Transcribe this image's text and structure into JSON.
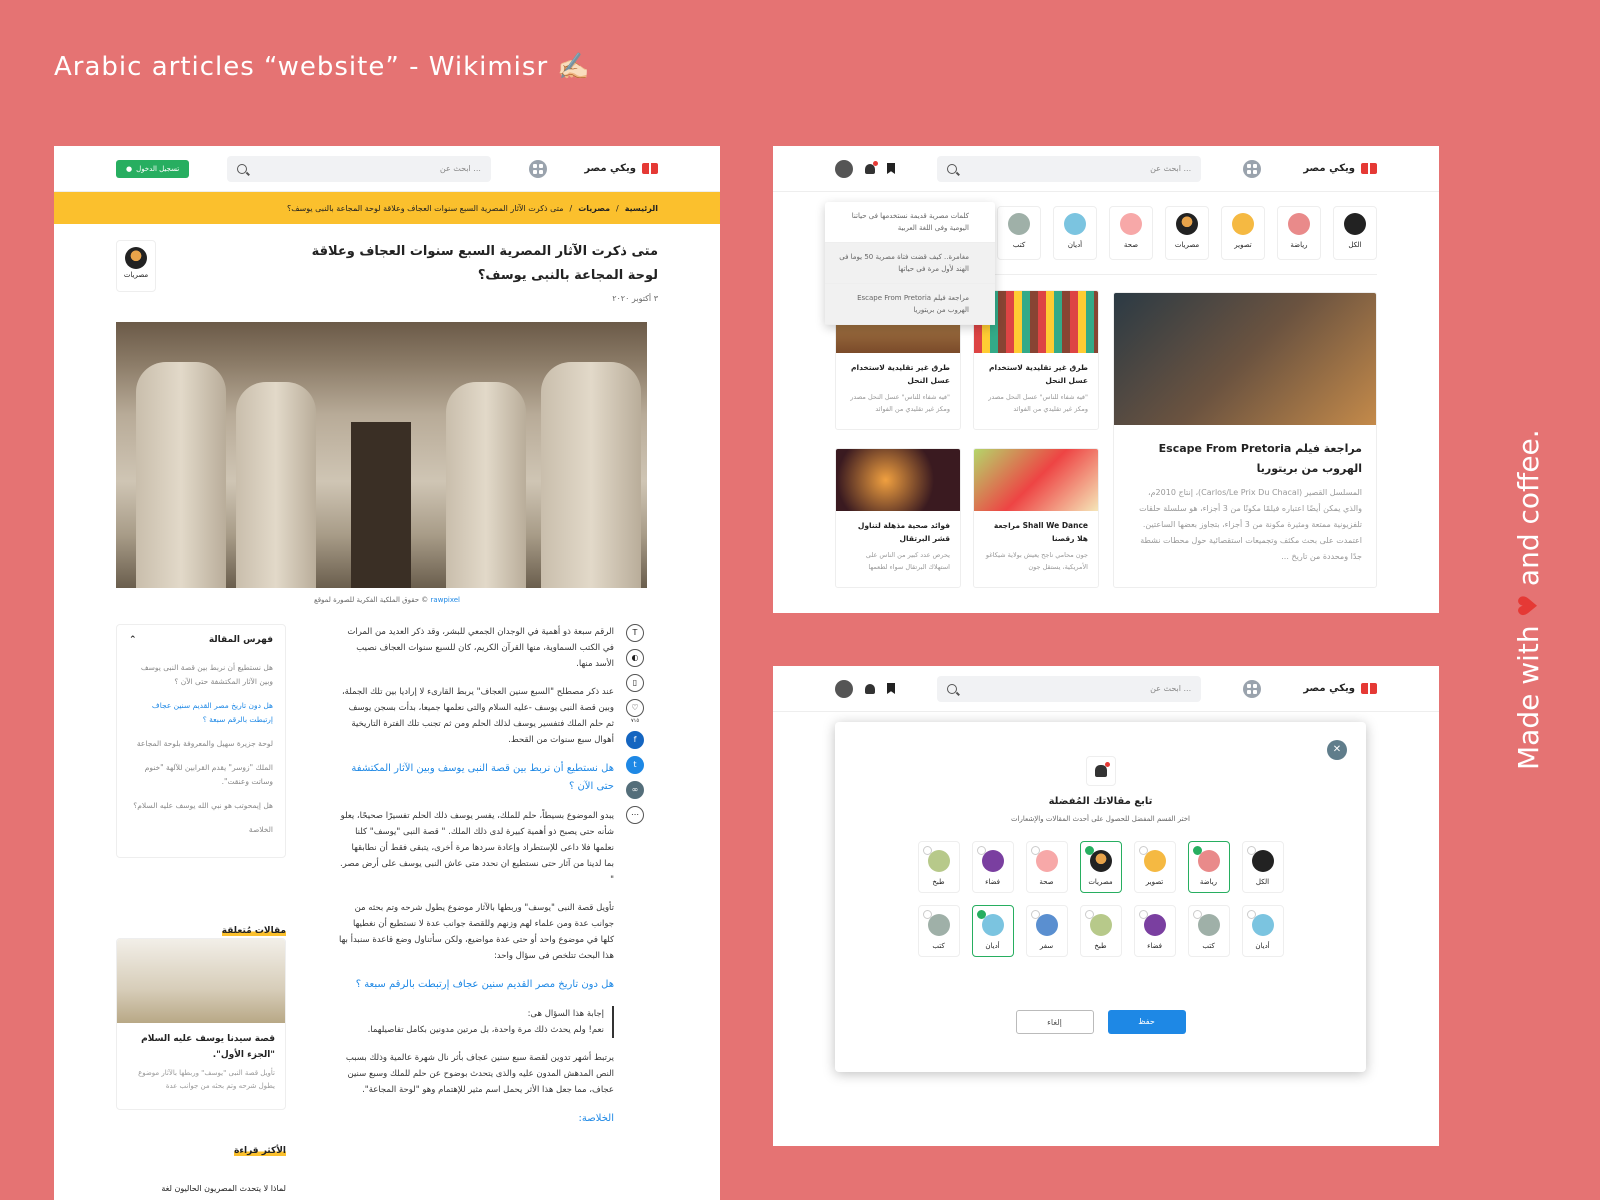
{
  "title": "Arabic articles “website” - Wikimisr ✍🏻",
  "side": {
    "prefix": "Made with",
    "suffix": "and coffee."
  },
  "brand": "ويكي مصر",
  "search_placeholder": "ابحث عن ...",
  "login": "تسجيل الدخول",
  "crumbs": [
    "الرئيسية",
    "مصريات",
    "متى ذكرت الآثار المصرية السبع سنوات العجاف وعلاقة لوحة المجاعة بالنبى يوسف؟"
  ],
  "article": {
    "title": "متى ذكرت الآثار المصرية السبع سنوات العجاف وعلاقة لوحة المجاعة بالنبى يوسف؟",
    "date": "٣ أكتوبر ٢٠٢٠",
    "category": "مصريات",
    "credit": "© حقوق الملكية الفكرية للصورة لموقع",
    "credit_link": "rawpixel",
    "likes": "٧١٥"
  },
  "body": {
    "p1": "الرقم سبعة ذو أهمية في الوجدان الجمعي للبشر، وقد ذكر العديد من المرات في الكتب السماوية، منها القرآن الكريم، كان للسبع سنوات العجاف نصيب الأسد منها.",
    "p2": "عند ذكر مصطلح \"السبع سنين العجاف\" يربط القارىء لا إراديا بين تلك الجملة، وبين قصة النبى يوسف -عليه السلام والتى نعلمها جميعا، بدأت بسجن يوسف ثم حلم الملك فتفسير يوسف لذلك الحلم ومن ثم تجنب تلك الفترة التاريخية أهوال سبع سنوات من القحط.",
    "h1": "هل نستطيع أن نربط بين قصة النبى يوسف وبين الآثار المكتشفة حتى الآن ؟",
    "p3": "يبدو الموضوع بسيطاً، حلم للملك، يفسر يوسف ذلك الحلم تفسيرًا صحيحًا، يعلو شأنه حتى يصبح ذو أهمية كبيرة لدى ذلك الملك. \" قصة النبى \"يوسف\" كلنا نعلمها فلا داعى للإستطراد وإعادة سردها مرة أخرى، يتبقى فقط أن نطابقها بما لدينا من آثار حتى نستطيع ان نحدد متى عاش النبى يوسف على أرض مصر. \"",
    "p4": "تأويل قصة النبى \"يوسف\" وربطها بالآثار موضوع يطول شرحه وتم بحثه من جوانب عدة ومن علماء لهم وزنهم وللقصة جوانب عدة لا نستطيع أن نغطيها كلها في موضوع واحد أو حتى عدة مواضيع، ولكن سأتناول وضع قاعدة سنبدأ بها هذا البحث تتلخص فى سؤال واحد:",
    "h2": "هل دون تاريخ مصر القديم سنين عجاف إرتبطت بالرقم سبعة ؟",
    "q1": "إجابة هذا السؤال هى:",
    "q2": "نعم! ولم يحدث ذلك مرة واحدة، بل مرتين مدونين بكامل تفاصيلهما.",
    "p5": "يرتبط أشهر تدوين لقصة سبع سنين عجاف بأثر نال شهرة عالمية وذلك بسبب النص المدهش المدون عليه والذى يتحدث بوضوح عن حلم للملك وسبع سنين عجاف، مما جعل هذا الأثر يحمل اسم مثير للإهتمام وهو \"لوحة المجاعة\".",
    "h3": "الخلاصة:"
  },
  "toc": {
    "title": "فهرس المقالة",
    "items": [
      "هل نستطيع أن نربط بين قصة النبى يوسف وبين الآثار المكتشفة حتى الآن ؟",
      "هل دون تاريخ مصر القديم سنين عجاف إرتبطت بالرقم سبعة ؟",
      "لوحة جزيرة سهيل والمعروفة بلوحة المجاعة",
      "الملك \"زوسر\" يقدم القرابين للآلهة \"خنوم وساتت وعنقت\".",
      "هل إيمحوتب هو نبي الله يوسف عليه السلام؟",
      "الخلاصة"
    ]
  },
  "related": {
    "title": "مقالات مُتعلقة",
    "card_title": "قصة سيدنا يوسف عليه السلام \"الجزء الأول\".",
    "card_desc": "تأويل قصة النبى \"يوسف\" وربطها بالآثار موضوع يطول شرحه وتم بحثه من جوانب عدة"
  },
  "popular": {
    "title": "الأكثر قراءة",
    "first": "لماذا لا يتحدث المصريون الحاليون لغة"
  },
  "categories": [
    "الكل",
    "رياضة",
    "تصوير",
    "مصريات",
    "صحة",
    "أديان",
    "كتب"
  ],
  "notifications": [
    "كلمات مصرية قديمة نستخدمها فى حياتنا اليومية وفى اللغة العربية",
    "مغامرة.. كيف قضت فتاة مصرية 50 يوما فى الهند لأول مرة فى حياتها",
    "مراجعة فيلم Escape From Pretoria الهروب من بريتوريا"
  ],
  "cards": [
    {
      "title": "طرق غير تقليدية لاستخدام عسل النحل",
      "desc": "\"فيه شفاء للناس\" عسل النحل مصدر ومكز غير تقليدي من الفوائد"
    },
    {
      "title": "طرق غير تقليدية لاستخدام عسل النحل",
      "desc": "\"فيه شفاء للناس\" عسل النحل مصدر ومكز غير تقليدي من الفوائد"
    },
    {
      "title": "Shall We Dance مراجعة هلا رقصنا",
      "desc": "جون محامي ناجح يعيش بولاية شيكاغو الأمريكية، يستقل جون"
    },
    {
      "title": "فوائد صحية مذهلة لتناول قشر البرتقال",
      "desc": "يحرص عدد كبير من الناس على استهلاك البرتقال سواء لطعمها"
    }
  ],
  "big_card": {
    "title": "مراجعة فيلم Escape From Pretoria الهروب من بريتوريا",
    "desc": "المسلسل القصير (Carlos/Le Prix Du Chacal)، إنتاج 2010م، والذي يمكن أيضًا اعتباره فيلمًا مكونًا من 3 أجزاء، هو سلسلة حلقات تلفزيونية ممتعة ومثيرة مكونة من 3 أجزاء، بتجاوز بعضها الساعتين. اعتمدت على بحث مكثف وتجميعات استقصائية حول محطات نشطة جدًا ومحددة من تاريخ ..."
  },
  "modal": {
    "title": "تابع مقالاتك المُفضلة",
    "subtitle": "اختر القسم المفضل للحصول على أحدث المقالات والإشعارات",
    "row1": [
      "الكل",
      "رياضة",
      "تصوير",
      "مصريات",
      "صحة",
      "فضاء",
      "طبخ"
    ],
    "row2": [
      "أديان",
      "كتب",
      "فضاء",
      "طبخ",
      "سفر",
      "أديان",
      "كتب"
    ],
    "save": "حفظ",
    "cancel": "إلغاء"
  },
  "colors": {
    "bg": "#E57373",
    "accent": "#FBC02D",
    "link": "#1E88E5",
    "green": "#27AE60"
  }
}
